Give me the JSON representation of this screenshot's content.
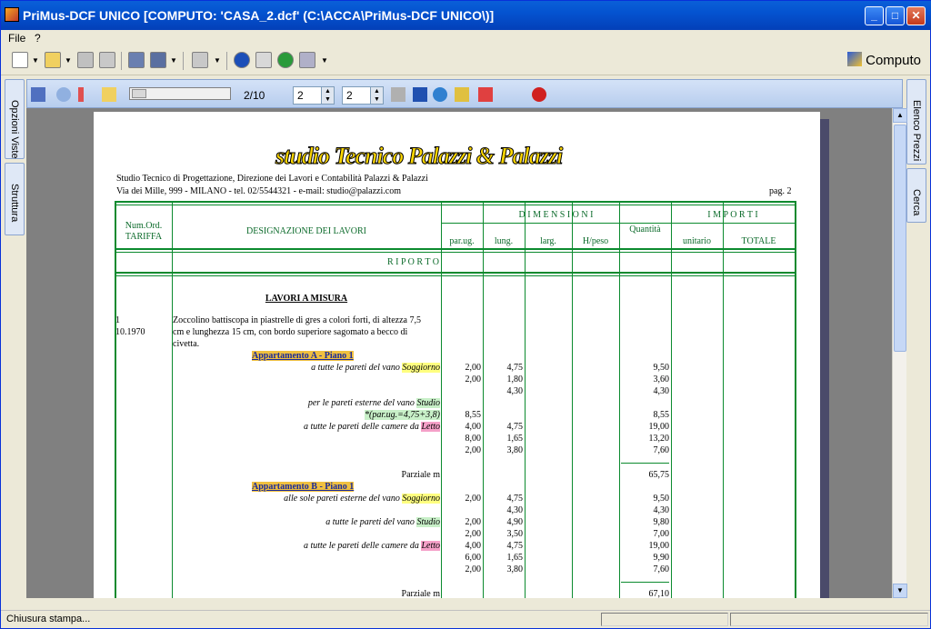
{
  "window": {
    "title": "PriMus-DCF   UNICO   [COMPUTO: 'CASA_2.dcf'   (C:\\ACCA\\PriMus-DCF UNICO\\)]"
  },
  "menu": [
    "File",
    "?"
  ],
  "toolbar": {
    "mode_label": "Computo"
  },
  "preview_toolbar": {
    "page_indicator": "2/10",
    "from_page": "2",
    "to_page": "2"
  },
  "left_tabs": [
    "Opzioni Viste",
    "Struttura"
  ],
  "right_tabs": [
    "Elenco Prezzi",
    "Cerca"
  ],
  "document": {
    "logo_text": "studio Tecnico Palazzi & Palazzi",
    "header_line1": "Studio Tecnico di Progettazione, Direzione dei Lavori e Contabilità Palazzi & Palazzi",
    "header_line2": "Via dei Mille, 999 - MILANO - tel. 02/5544321 -  e-mail: studio@palazzi.com",
    "page_label": "pag. 2",
    "columns": {
      "num": "Num.Ord.",
      "tariffa": "TARIFFA",
      "designazione": "DESIGNAZIONE DEI LAVORI",
      "dimensioni": "D I M E N S I O N I",
      "parug": "par.ug.",
      "lung": "lung.",
      "larg": "larg.",
      "hpeso": "H/peso",
      "quantita": "Quantità",
      "importi": "I M P O R T I",
      "unitario": "unitario",
      "totale": "TOTALE"
    },
    "riporto": "R I P O R T O",
    "section_title": "LAVORI A MISURA",
    "item": {
      "num": "1",
      "code": "10.1970",
      "desc": [
        "Zoccolino battiscopa in piastrelle di gres a colori forti, di altezza 7,5",
        "cm e lunghezza 15 cm, con bordo superiore  sagomato a becco di",
        "civetta."
      ]
    },
    "groups": [
      {
        "title": "Appartamento A - Piano 1",
        "rows": [
          {
            "label": "a tutte le pareti del vano ",
            "room": "Soggiorno",
            "room_color": "#ffff80",
            "par": "2,00",
            "lung": "4,75",
            "q": "9,50"
          },
          {
            "label": "",
            "room": "",
            "par": "2,00",
            "lung": "1,80",
            "q": "3,60"
          },
          {
            "label": "",
            "room": "",
            "par": "",
            "lung": "4,30",
            "q": "4,30"
          },
          {
            "label": "per le pareti esterne del vano ",
            "room": "Studio",
            "room_color": "#c8f0c8",
            "par": "",
            "lung": "",
            "q": ""
          },
          {
            "label": "*(par.ug.=4,75+3,8)",
            "room": "",
            "par": "8,55",
            "lung": "",
            "q": "8,55",
            "shade": "#c8f0c8"
          },
          {
            "label": "a tutte le pareti delle camere da ",
            "room": "Letto",
            "room_color": "#f5a0c8",
            "par": "4,00",
            "lung": "4,75",
            "q": "19,00"
          },
          {
            "label": "",
            "room": "",
            "par": "8,00",
            "lung": "1,65",
            "q": "13,20"
          },
          {
            "label": "",
            "room": "",
            "par": "2,00",
            "lung": "3,80",
            "q": "7,60"
          }
        ],
        "partial_label": "Parziale m",
        "partial": "65,75"
      },
      {
        "title": "Appartamento B - Piano 1",
        "rows": [
          {
            "label": "alle sole pareti esterne del vano ",
            "room": "Soggiorno",
            "room_color": "#ffff80",
            "par": "2,00",
            "lung": "4,75",
            "q": "9,50"
          },
          {
            "label": "",
            "room": "",
            "par": "",
            "lung": "4,30",
            "q": "4,30"
          },
          {
            "label": "a tutte le pareti del vano ",
            "room": "Studio",
            "room_color": "#c8f0c8",
            "par": "2,00",
            "lung": "4,90",
            "q": "9,80"
          },
          {
            "label": "",
            "room": "",
            "par": "2,00",
            "lung": "3,50",
            "q": "7,00"
          },
          {
            "label": "a tutte le pareti delle camere da ",
            "room": "Letto",
            "room_color": "#f5a0c8",
            "par": "4,00",
            "lung": "4,75",
            "q": "19,00"
          },
          {
            "label": "",
            "room": "",
            "par": "6,00",
            "lung": "1,65",
            "q": "9,90"
          },
          {
            "label": "",
            "room": "",
            "par": "2,00",
            "lung": "3,80",
            "q": "7,60"
          }
        ],
        "partial_label": "Parziale m",
        "partial": "67,10"
      }
    ]
  },
  "status": {
    "text": "Chiusura stampa..."
  }
}
